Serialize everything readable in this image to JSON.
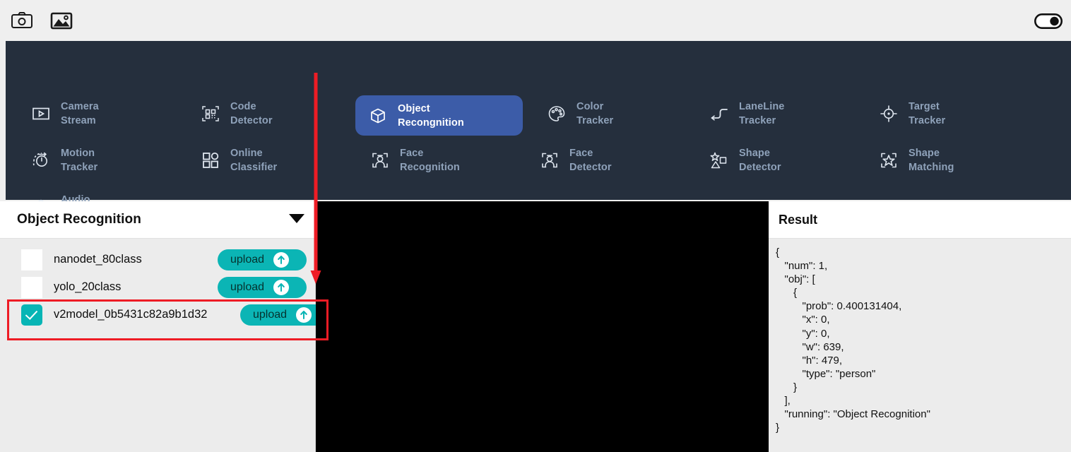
{
  "toolbar": {
    "camera_icon": "camera-icon",
    "gallery_icon": "image-icon",
    "toggle_state": "on",
    "toggle_icon": "toggle-switch-on-icon"
  },
  "nav": {
    "items": [
      {
        "label": "Camera\nStream",
        "icon": "video-play-icon",
        "active": false
      },
      {
        "label": "Code\nDetector",
        "icon": "qr-code-icon",
        "active": false
      },
      {
        "label": "Object\nRecongnition",
        "icon": "cube-icon",
        "active": true
      },
      {
        "label": "Color\nTracker",
        "icon": "palette-icon",
        "active": false
      },
      {
        "label": "LaneLine\nTracker",
        "icon": "lane-line-icon",
        "active": false
      },
      {
        "label": "Target\nTracker",
        "icon": "crosshair-icon",
        "active": false
      },
      {
        "label": "Motion\nTracker",
        "icon": "motion-dial-icon",
        "active": false
      },
      {
        "label": "Online\nClassifier",
        "icon": "grid-shapes-icon",
        "active": false
      },
      {
        "label": "Face\nRecognition",
        "icon": "face-scan-icon",
        "active": false
      },
      {
        "label": "Face\nDetector",
        "icon": "face-scan-icon",
        "active": false
      },
      {
        "label": "Shape\nDetector",
        "icon": "shapes-icon",
        "active": false
      },
      {
        "label": "Shape\nMatching",
        "icon": "shape-scan-icon",
        "active": false
      },
      {
        "label": "Audio\nFFT",
        "icon": "microphone-icon",
        "active": false
      }
    ]
  },
  "left_panel": {
    "title": "Object Recognition",
    "caret_icon": "chevron-down-icon",
    "models": [
      {
        "name": "nanodet_80class",
        "checked": false,
        "upload_label": "upload",
        "upload_icon": "upload-arrow-icon"
      },
      {
        "name": "yolo_20class",
        "checked": false,
        "upload_label": "upload",
        "upload_icon": "upload-arrow-icon"
      },
      {
        "name": "v2model_0b5431c82a9b1d32",
        "checked": true,
        "upload_label": "upload",
        "upload_icon": "upload-arrow-icon"
      }
    ]
  },
  "result_panel": {
    "title": "Result",
    "json_text": "{\n   \"num\": 1,\n   \"obj\": [\n      {\n         \"prob\": 0.400131404,\n         \"x\": 0,\n         \"y\": 0,\n         \"w\": 639,\n         \"h\": 479,\n         \"type\": \"person\"\n      }\n   ],\n   \"running\": \"Object Recognition\"\n}"
  },
  "annotations": {
    "arrow_color": "#ee1c25",
    "box_color": "#ee1c25"
  },
  "colors": {
    "nav_background": "#252f3d",
    "active_tab": "#3c5ca8",
    "accent_teal": "#0bb5b5",
    "panel_background": "#ececec",
    "video_background": "#000000"
  }
}
